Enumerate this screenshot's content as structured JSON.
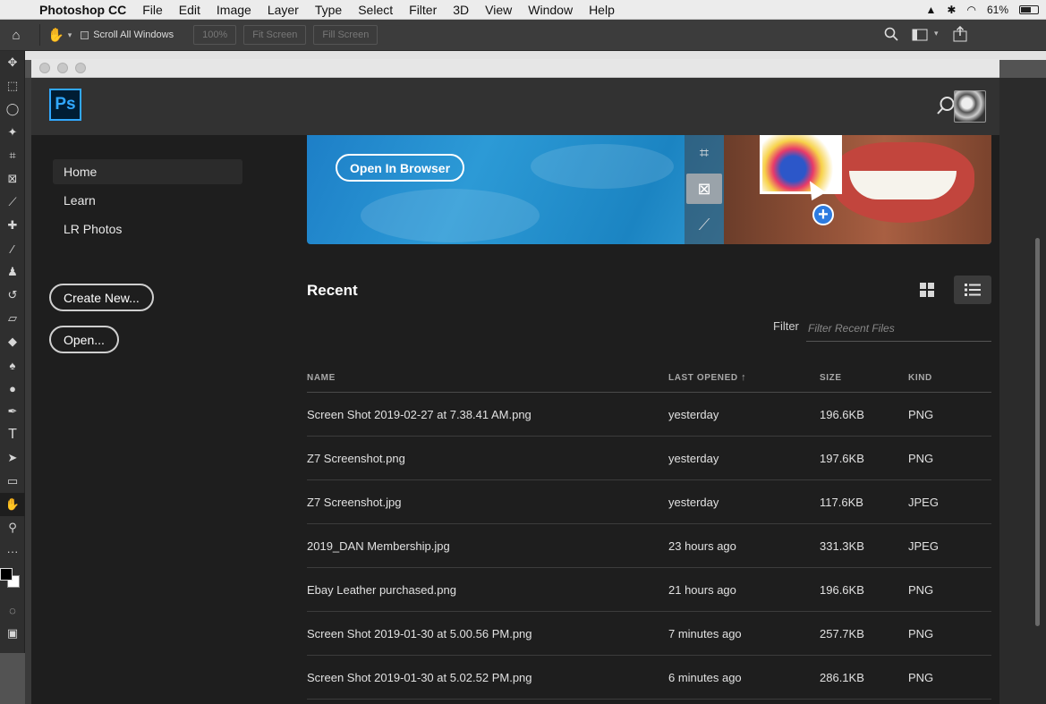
{
  "menubar": {
    "app_name": "Photoshop CC",
    "menus": [
      "File",
      "Edit",
      "Image",
      "Layer",
      "Type",
      "Select",
      "Filter",
      "3D",
      "View",
      "Window",
      "Help"
    ],
    "battery": "61%"
  },
  "optionsbar": {
    "scroll_all_windows": "Scroll All Windows",
    "zoom_value": "100%",
    "fit_screen": "Fit Screen",
    "fill_screen": "Fill Screen"
  },
  "tools": [
    "move-tool",
    "marquee-tool",
    "lasso-tool",
    "magic-wand-tool",
    "crop-tool",
    "frame-tool",
    "eyedropper-tool",
    "healing-tool",
    "brush-tool",
    "stamp-tool",
    "history-brush-tool",
    "eraser-tool",
    "paint-bucket-tool",
    "blur-tool",
    "dodge-tool",
    "pen-tool",
    "type-tool",
    "path-selection-tool",
    "rectangle-tool",
    "hand-tool",
    "zoom-tool",
    "more-tools"
  ],
  "start": {
    "logo": "Ps",
    "nav": [
      {
        "label": "Home",
        "selected": true
      },
      {
        "label": "Learn",
        "selected": false
      },
      {
        "label": "LR Photos",
        "selected": false
      }
    ],
    "create_new": "Create New...",
    "open": "Open...",
    "banner_button": "Open In Browser"
  },
  "recent": {
    "title": "Recent",
    "filter_label": "Filter",
    "filter_placeholder": "Filter Recent Files",
    "columns": [
      "NAME",
      "LAST OPENED",
      "SIZE",
      "KIND"
    ],
    "files": [
      {
        "name": "Screen Shot 2019-02-27 at 7.38.41 AM.png",
        "opened": "yesterday",
        "size": "196.6KB",
        "kind": "PNG"
      },
      {
        "name": "Z7 Screenshot.png",
        "opened": "yesterday",
        "size": "197.6KB",
        "kind": "PNG"
      },
      {
        "name": "Z7 Screenshot.jpg",
        "opened": "yesterday",
        "size": "117.6KB",
        "kind": "JPEG"
      },
      {
        "name": "2019_DAN Membership.jpg",
        "opened": "23 hours ago",
        "size": "331.3KB",
        "kind": "JPEG"
      },
      {
        "name": "Ebay Leather purchased.png",
        "opened": "21 hours ago",
        "size": "196.6KB",
        "kind": "PNG"
      },
      {
        "name": "Screen Shot 2019-01-30 at 5.00.56 PM.png",
        "opened": "7 minutes ago",
        "size": "257.7KB",
        "kind": "PNG"
      },
      {
        "name": "Screen Shot 2019-01-30 at 5.02.52 PM.png",
        "opened": "6 minutes ago",
        "size": "286.1KB",
        "kind": "PNG"
      }
    ]
  },
  "colors": {
    "accent": "#31a8ff",
    "window_bg": "#1e1e1e",
    "header_bg": "#323232"
  }
}
